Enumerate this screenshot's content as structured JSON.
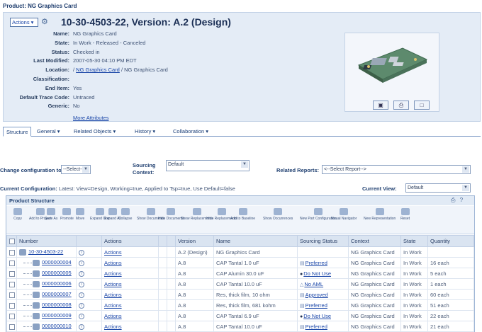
{
  "breadcrumb": "Product: NG Graphics Card",
  "header": {
    "actions_label": "Actions ▾",
    "title": "10-30-4503-22, Version: A.2 (Design)",
    "attributes": [
      {
        "label": "Name:",
        "value": "NG Graphics Card"
      },
      {
        "label": "State:",
        "value": "In Work - Released - Canceled"
      },
      {
        "label": "Status:",
        "value": "Checked in"
      },
      {
        "label": "Last Modified:",
        "value": "2007-05-30 04:10 PM EDT"
      },
      {
        "label": "Location:",
        "value_prefix": "/ ",
        "value_link": "NG Graphics Card",
        "value_suffix": " / NG Graphics Card"
      },
      {
        "label": "Classification:",
        "value": ""
      },
      {
        "label": "End Item:",
        "value": "Yes"
      },
      {
        "label": "Default Trace Code:",
        "value": "Untraced"
      },
      {
        "label": "Generic:",
        "value": "No"
      }
    ],
    "more_attributes": "More Attributes"
  },
  "tabs": [
    {
      "label": "Structure"
    },
    {
      "label": "General ▾"
    },
    {
      "label": "Related Objects ▾"
    },
    {
      "label": "History ▾"
    },
    {
      "label": "Collaboration ▾"
    }
  ],
  "config": {
    "change_label": "Change configuration to:",
    "change_value": "--Select--",
    "sourcing_label_1": "Sourcing",
    "sourcing_label_2": "Context:",
    "sourcing_value": "Default",
    "related_reports_label": "Related Reports:",
    "related_reports_value": "<--Select Report-->",
    "current_config_label": "Current Configuration:",
    "current_config_value": "Latest: View=Design, Working=true, Applied to Tsp=true, Use Default=false",
    "current_view_label": "Current View:",
    "current_view_value": "Default"
  },
  "product_structure": {
    "title": "Product Structure",
    "toolbar": [
      {
        "label": "Copy",
        "icon": "copy-icon"
      },
      {
        "label": "Add to Project",
        "icon": "add-to-project-icon"
      },
      {
        "label": "Save As",
        "icon": "save-as-icon"
      },
      {
        "label": "Promote",
        "icon": "promote-icon"
      },
      {
        "label": "Move",
        "icon": "move-icon"
      },
      {
        "label": "Expand One",
        "icon": "expand-one-icon"
      },
      {
        "label": "Expand All",
        "icon": "expand-all-icon"
      },
      {
        "label": "Collapse",
        "icon": "collapse-icon"
      },
      {
        "label": "Show Documents",
        "icon": "show-documents-icon"
      },
      {
        "label": "Hide Documents",
        "icon": "hide-documents-icon"
      },
      {
        "label": "Show Replacements",
        "icon": "show-replacements-icon"
      },
      {
        "label": "Hide Replacements",
        "icon": "hide-replacements-icon"
      },
      {
        "label": "Add to Baseline",
        "icon": "add-to-baseline-icon"
      },
      {
        "label": "Show Occurrences",
        "icon": "show-occurrences-icon"
      },
      {
        "label": "New Part Configuration",
        "icon": "new-part-configuration-icon"
      },
      {
        "label": "Visual Navigator",
        "icon": "visual-navigator-icon"
      },
      {
        "label": "New Representation",
        "icon": "new-representation-icon"
      },
      {
        "label": "Reset",
        "icon": "reset-icon"
      }
    ],
    "columns": [
      "Number",
      "Actions",
      "Version",
      "Name",
      "Sourcing Status",
      "Context",
      "State",
      "Quantity"
    ],
    "rows": [
      {
        "number": "10-30-4503-22",
        "actions": "Actions",
        "version": "A.2 (Design)",
        "name": "NG Graphics Card",
        "sourcing": "",
        "context": "NG Graphics Card",
        "state": "In Work",
        "quantity": "",
        "root": true
      },
      {
        "number": "0000000004",
        "actions": "Actions",
        "version": "A.8",
        "name": "CAP Tantal 1.0 uF",
        "sourcing": "Preferred",
        "context": "NG Graphics Card",
        "state": "In Work",
        "quantity": "16 each"
      },
      {
        "number": "0000000005",
        "actions": "Actions",
        "version": "A.8",
        "name": "CAP Alumin 30.0 uF",
        "sourcing": "Do Not Use",
        "context": "NG Graphics Card",
        "state": "In Work",
        "quantity": "5 each"
      },
      {
        "number": "0000000006",
        "actions": "Actions",
        "version": "A.8",
        "name": "CAP Tantal 10.0 uF",
        "sourcing": "No AML",
        "context": "NG Graphics Card",
        "state": "In Work",
        "quantity": "1 each"
      },
      {
        "number": "0000000007",
        "actions": "Actions",
        "version": "A.8",
        "name": "Res, thick film, 10 ohm",
        "sourcing": "Approved",
        "context": "NG Graphics Card",
        "state": "In Work",
        "quantity": "60 each"
      },
      {
        "number": "0000000008",
        "actions": "Actions",
        "version": "A.8",
        "name": "Res, thick film, 681 kohm",
        "sourcing": "Preferred",
        "context": "NG Graphics Card",
        "state": "In Work",
        "quantity": "51 each"
      },
      {
        "number": "0000000009",
        "actions": "Actions",
        "version": "A.8",
        "name": "CAP Tantal 6.9 uF",
        "sourcing": "Do Not Use",
        "context": "NG Graphics Card",
        "state": "In Work",
        "quantity": "22 each"
      },
      {
        "number": "0000000010",
        "actions": "Actions",
        "version": "A.8",
        "name": "CAP Tantal 10.0 uF",
        "sourcing": "Preferred",
        "context": "NG Graphics Card",
        "state": "In Work",
        "quantity": "21 each"
      }
    ]
  }
}
